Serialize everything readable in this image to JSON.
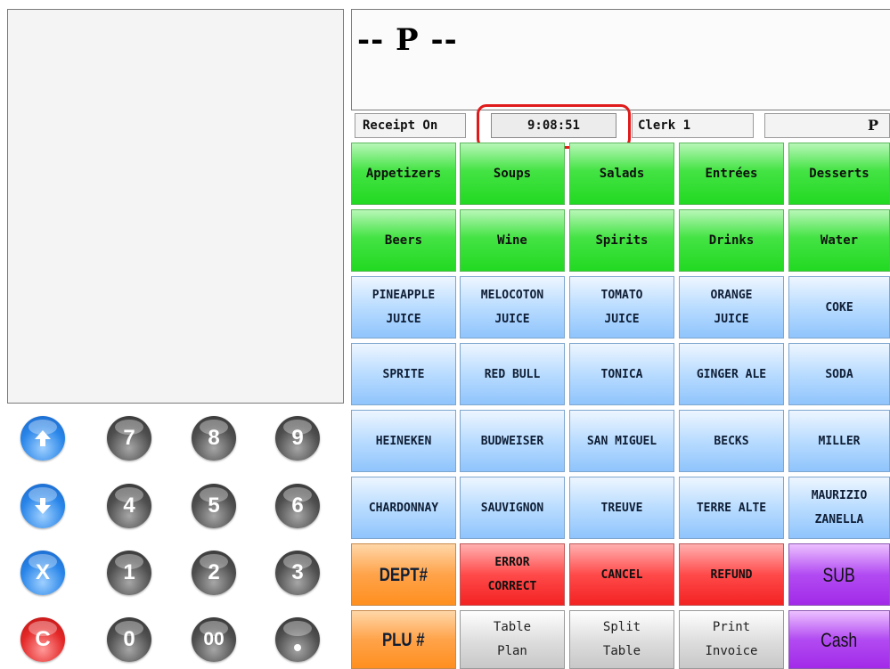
{
  "display": {
    "text": "-- P --"
  },
  "status_bar": {
    "receipt": "Receipt On",
    "time": "9:08:51",
    "clerk": "Clerk 1",
    "price_level": "P"
  },
  "categories": {
    "row1": [
      "Appetizers",
      "Soups",
      "Salads",
      "Entrées",
      "Desserts"
    ],
    "row2": [
      "Beers",
      "Wine",
      "Spirits",
      "Drinks",
      "Water"
    ]
  },
  "products": {
    "row1": [
      {
        "line1": "PINEAPPLE",
        "line2": "JUICE"
      },
      {
        "line1": "MELOCOTON",
        "line2": "JUICE"
      },
      {
        "line1": "TOMATO",
        "line2": "JUICE"
      },
      {
        "line1": "ORANGE",
        "line2": "JUICE"
      },
      {
        "line1": "COKE",
        "line2": ""
      }
    ],
    "row2": [
      "SPRITE",
      "RED BULL",
      "TONICA",
      "GINGER ALE",
      "SODA"
    ],
    "row3": [
      "HEINEKEN",
      "BUDWEISER",
      "SAN MIGUEL",
      "BECKS",
      "MILLER"
    ],
    "row4": [
      {
        "line1": "CHARDONNAY",
        "line2": ""
      },
      {
        "line1": "SAUVIGNON",
        "line2": ""
      },
      {
        "line1": "TREUVE",
        "line2": ""
      },
      {
        "line1": "TERRE ALTE",
        "line2": ""
      },
      {
        "line1": "MAURIZIO",
        "line2": "ZANELLA"
      }
    ]
  },
  "functions": {
    "dept": "DEPT#",
    "error_correct": {
      "line1": "ERROR",
      "line2": "CORRECT"
    },
    "cancel": "CANCEL",
    "refund": "REFUND",
    "sub": "SUB",
    "plu": "PLU #",
    "table_plan": {
      "line1": "Table",
      "line2": "Plan"
    },
    "split_table": {
      "line1": "Split",
      "line2": "Table"
    },
    "print_invoice": {
      "line1": "Print",
      "line2": "Invoice"
    },
    "cash": "Cash"
  },
  "keypad": {
    "x_label": "X",
    "c_label": "C",
    "digits": [
      "7",
      "8",
      "9",
      "4",
      "5",
      "6",
      "1",
      "2",
      "3",
      "0",
      "00"
    ]
  }
}
